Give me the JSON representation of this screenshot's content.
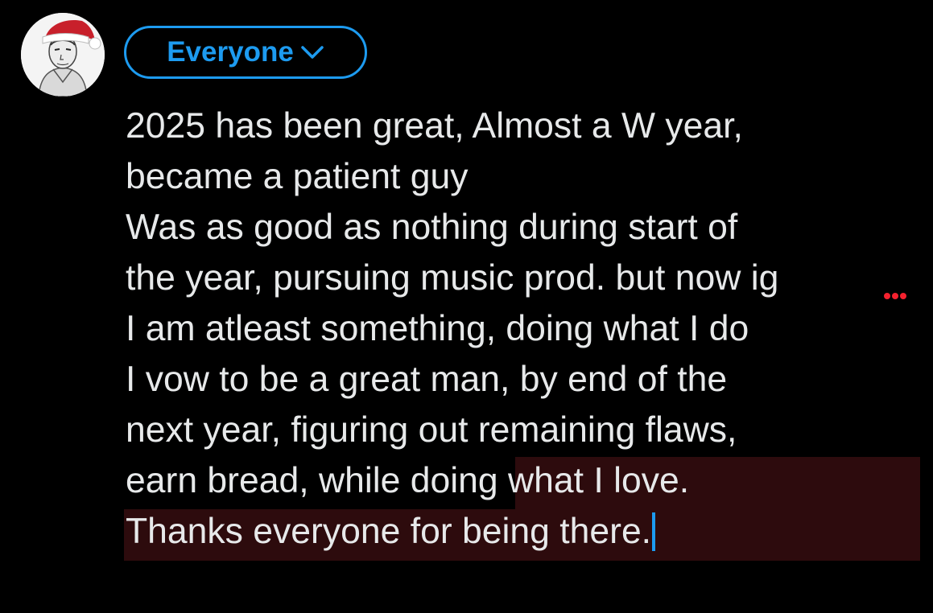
{
  "audience": {
    "label": "Everyone"
  },
  "icons": {
    "avatar": "santa-hat-sketch-avatar",
    "audience_chevron": "chevron-down-icon"
  },
  "colors": {
    "background": "#000000",
    "text": "#e7e9ea",
    "accent": "#1d9bf0",
    "selection": "#2d0b0d",
    "spellcheck": "#f4212e"
  },
  "composer": {
    "lines": [
      "2025 has been great, Almost a W year,",
      "became a patient guy",
      "Was as good as nothing during start of",
      "the year, pursuing music prod. but now ig",
      "I am atleast something, doing what I do",
      "I vow to be a great man, by end of the",
      "next year, figuring out remaining flaws,",
      "earn bread, while doing what I love.",
      "Thanks everyone for being there."
    ]
  }
}
